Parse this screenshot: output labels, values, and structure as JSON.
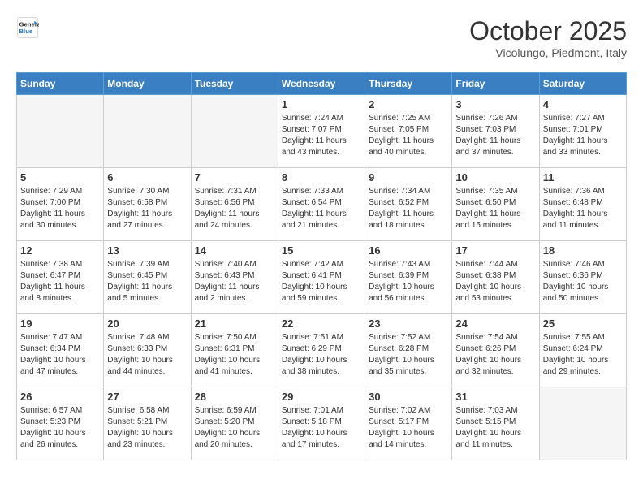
{
  "header": {
    "logo_line1": "General",
    "logo_line2": "Blue",
    "month": "October 2025",
    "location": "Vicolungo, Piedmont, Italy"
  },
  "weekdays": [
    "Sunday",
    "Monday",
    "Tuesday",
    "Wednesday",
    "Thursday",
    "Friday",
    "Saturday"
  ],
  "weeks": [
    [
      {
        "num": "",
        "sunrise": "",
        "sunset": "",
        "daylight": "",
        "empty": true
      },
      {
        "num": "",
        "sunrise": "",
        "sunset": "",
        "daylight": "",
        "empty": true
      },
      {
        "num": "",
        "sunrise": "",
        "sunset": "",
        "daylight": "",
        "empty": true
      },
      {
        "num": "1",
        "sunrise": "Sunrise: 7:24 AM",
        "sunset": "Sunset: 7:07 PM",
        "daylight": "Daylight: 11 hours and 43 minutes.",
        "empty": false
      },
      {
        "num": "2",
        "sunrise": "Sunrise: 7:25 AM",
        "sunset": "Sunset: 7:05 PM",
        "daylight": "Daylight: 11 hours and 40 minutes.",
        "empty": false
      },
      {
        "num": "3",
        "sunrise": "Sunrise: 7:26 AM",
        "sunset": "Sunset: 7:03 PM",
        "daylight": "Daylight: 11 hours and 37 minutes.",
        "empty": false
      },
      {
        "num": "4",
        "sunrise": "Sunrise: 7:27 AM",
        "sunset": "Sunset: 7:01 PM",
        "daylight": "Daylight: 11 hours and 33 minutes.",
        "empty": false
      }
    ],
    [
      {
        "num": "5",
        "sunrise": "Sunrise: 7:29 AM",
        "sunset": "Sunset: 7:00 PM",
        "daylight": "Daylight: 11 hours and 30 minutes.",
        "empty": false
      },
      {
        "num": "6",
        "sunrise": "Sunrise: 7:30 AM",
        "sunset": "Sunset: 6:58 PM",
        "daylight": "Daylight: 11 hours and 27 minutes.",
        "empty": false
      },
      {
        "num": "7",
        "sunrise": "Sunrise: 7:31 AM",
        "sunset": "Sunset: 6:56 PM",
        "daylight": "Daylight: 11 hours and 24 minutes.",
        "empty": false
      },
      {
        "num": "8",
        "sunrise": "Sunrise: 7:33 AM",
        "sunset": "Sunset: 6:54 PM",
        "daylight": "Daylight: 11 hours and 21 minutes.",
        "empty": false
      },
      {
        "num": "9",
        "sunrise": "Sunrise: 7:34 AM",
        "sunset": "Sunset: 6:52 PM",
        "daylight": "Daylight: 11 hours and 18 minutes.",
        "empty": false
      },
      {
        "num": "10",
        "sunrise": "Sunrise: 7:35 AM",
        "sunset": "Sunset: 6:50 PM",
        "daylight": "Daylight: 11 hours and 15 minutes.",
        "empty": false
      },
      {
        "num": "11",
        "sunrise": "Sunrise: 7:36 AM",
        "sunset": "Sunset: 6:48 PM",
        "daylight": "Daylight: 11 hours and 11 minutes.",
        "empty": false
      }
    ],
    [
      {
        "num": "12",
        "sunrise": "Sunrise: 7:38 AM",
        "sunset": "Sunset: 6:47 PM",
        "daylight": "Daylight: 11 hours and 8 minutes.",
        "empty": false
      },
      {
        "num": "13",
        "sunrise": "Sunrise: 7:39 AM",
        "sunset": "Sunset: 6:45 PM",
        "daylight": "Daylight: 11 hours and 5 minutes.",
        "empty": false
      },
      {
        "num": "14",
        "sunrise": "Sunrise: 7:40 AM",
        "sunset": "Sunset: 6:43 PM",
        "daylight": "Daylight: 11 hours and 2 minutes.",
        "empty": false
      },
      {
        "num": "15",
        "sunrise": "Sunrise: 7:42 AM",
        "sunset": "Sunset: 6:41 PM",
        "daylight": "Daylight: 10 hours and 59 minutes.",
        "empty": false
      },
      {
        "num": "16",
        "sunrise": "Sunrise: 7:43 AM",
        "sunset": "Sunset: 6:39 PM",
        "daylight": "Daylight: 10 hours and 56 minutes.",
        "empty": false
      },
      {
        "num": "17",
        "sunrise": "Sunrise: 7:44 AM",
        "sunset": "Sunset: 6:38 PM",
        "daylight": "Daylight: 10 hours and 53 minutes.",
        "empty": false
      },
      {
        "num": "18",
        "sunrise": "Sunrise: 7:46 AM",
        "sunset": "Sunset: 6:36 PM",
        "daylight": "Daylight: 10 hours and 50 minutes.",
        "empty": false
      }
    ],
    [
      {
        "num": "19",
        "sunrise": "Sunrise: 7:47 AM",
        "sunset": "Sunset: 6:34 PM",
        "daylight": "Daylight: 10 hours and 47 minutes.",
        "empty": false
      },
      {
        "num": "20",
        "sunrise": "Sunrise: 7:48 AM",
        "sunset": "Sunset: 6:33 PM",
        "daylight": "Daylight: 10 hours and 44 minutes.",
        "empty": false
      },
      {
        "num": "21",
        "sunrise": "Sunrise: 7:50 AM",
        "sunset": "Sunset: 6:31 PM",
        "daylight": "Daylight: 10 hours and 41 minutes.",
        "empty": false
      },
      {
        "num": "22",
        "sunrise": "Sunrise: 7:51 AM",
        "sunset": "Sunset: 6:29 PM",
        "daylight": "Daylight: 10 hours and 38 minutes.",
        "empty": false
      },
      {
        "num": "23",
        "sunrise": "Sunrise: 7:52 AM",
        "sunset": "Sunset: 6:28 PM",
        "daylight": "Daylight: 10 hours and 35 minutes.",
        "empty": false
      },
      {
        "num": "24",
        "sunrise": "Sunrise: 7:54 AM",
        "sunset": "Sunset: 6:26 PM",
        "daylight": "Daylight: 10 hours and 32 minutes.",
        "empty": false
      },
      {
        "num": "25",
        "sunrise": "Sunrise: 7:55 AM",
        "sunset": "Sunset: 6:24 PM",
        "daylight": "Daylight: 10 hours and 29 minutes.",
        "empty": false
      }
    ],
    [
      {
        "num": "26",
        "sunrise": "Sunrise: 6:57 AM",
        "sunset": "Sunset: 5:23 PM",
        "daylight": "Daylight: 10 hours and 26 minutes.",
        "empty": false
      },
      {
        "num": "27",
        "sunrise": "Sunrise: 6:58 AM",
        "sunset": "Sunset: 5:21 PM",
        "daylight": "Daylight: 10 hours and 23 minutes.",
        "empty": false
      },
      {
        "num": "28",
        "sunrise": "Sunrise: 6:59 AM",
        "sunset": "Sunset: 5:20 PM",
        "daylight": "Daylight: 10 hours and 20 minutes.",
        "empty": false
      },
      {
        "num": "29",
        "sunrise": "Sunrise: 7:01 AM",
        "sunset": "Sunset: 5:18 PM",
        "daylight": "Daylight: 10 hours and 17 minutes.",
        "empty": false
      },
      {
        "num": "30",
        "sunrise": "Sunrise: 7:02 AM",
        "sunset": "Sunset: 5:17 PM",
        "daylight": "Daylight: 10 hours and 14 minutes.",
        "empty": false
      },
      {
        "num": "31",
        "sunrise": "Sunrise: 7:03 AM",
        "sunset": "Sunset: 5:15 PM",
        "daylight": "Daylight: 10 hours and 11 minutes.",
        "empty": false
      },
      {
        "num": "",
        "sunrise": "",
        "sunset": "",
        "daylight": "",
        "empty": true
      }
    ]
  ]
}
